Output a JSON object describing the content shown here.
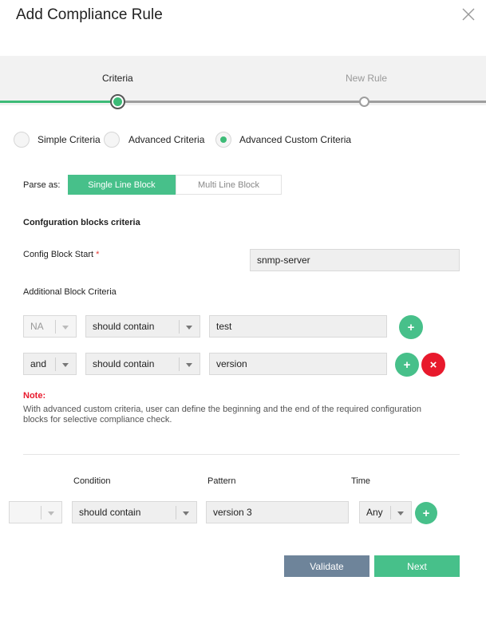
{
  "dialog": {
    "title": "Add Compliance Rule"
  },
  "stepper": {
    "steps": [
      "Criteria",
      "New Rule"
    ],
    "active_step": "Criteria"
  },
  "criteria_type": {
    "options": [
      "Simple Criteria",
      "Advanced Criteria",
      "Advanced Custom Criteria"
    ],
    "selected": "Advanced Custom Criteria"
  },
  "parse_as": {
    "label": "Parse as:",
    "options": [
      "Single Line Block",
      "Multi Line Block"
    ],
    "selected": "Single Line Block"
  },
  "config_blocks": {
    "heading": "Confguration blocks criteria",
    "start_label": "Config Block Start",
    "required_mark": "*",
    "start_value": "snmp-server",
    "additional_label": "Additional Block Criteria",
    "rows": [
      {
        "operator": "NA",
        "condition": "should contain",
        "value": "test"
      },
      {
        "operator": "and",
        "condition": "should contain",
        "value": "version"
      }
    ]
  },
  "note": {
    "title": "Note:",
    "text": "With advanced custom criteria, user can define the beginning and the end of the required configuration blocks for selective compliance check."
  },
  "rule_table": {
    "headers": [
      "Condition",
      "Pattern",
      "Time"
    ],
    "row": {
      "operator": "",
      "condition": "should contain",
      "pattern": "version 3",
      "time": "Any"
    }
  },
  "buttons": {
    "add": "+",
    "remove": "×",
    "validate": "Validate",
    "next": "Next"
  },
  "colors": {
    "accent_green": "#47c08a",
    "danger_red": "#e8192c",
    "validate_blue_grey": "#6e849a"
  }
}
